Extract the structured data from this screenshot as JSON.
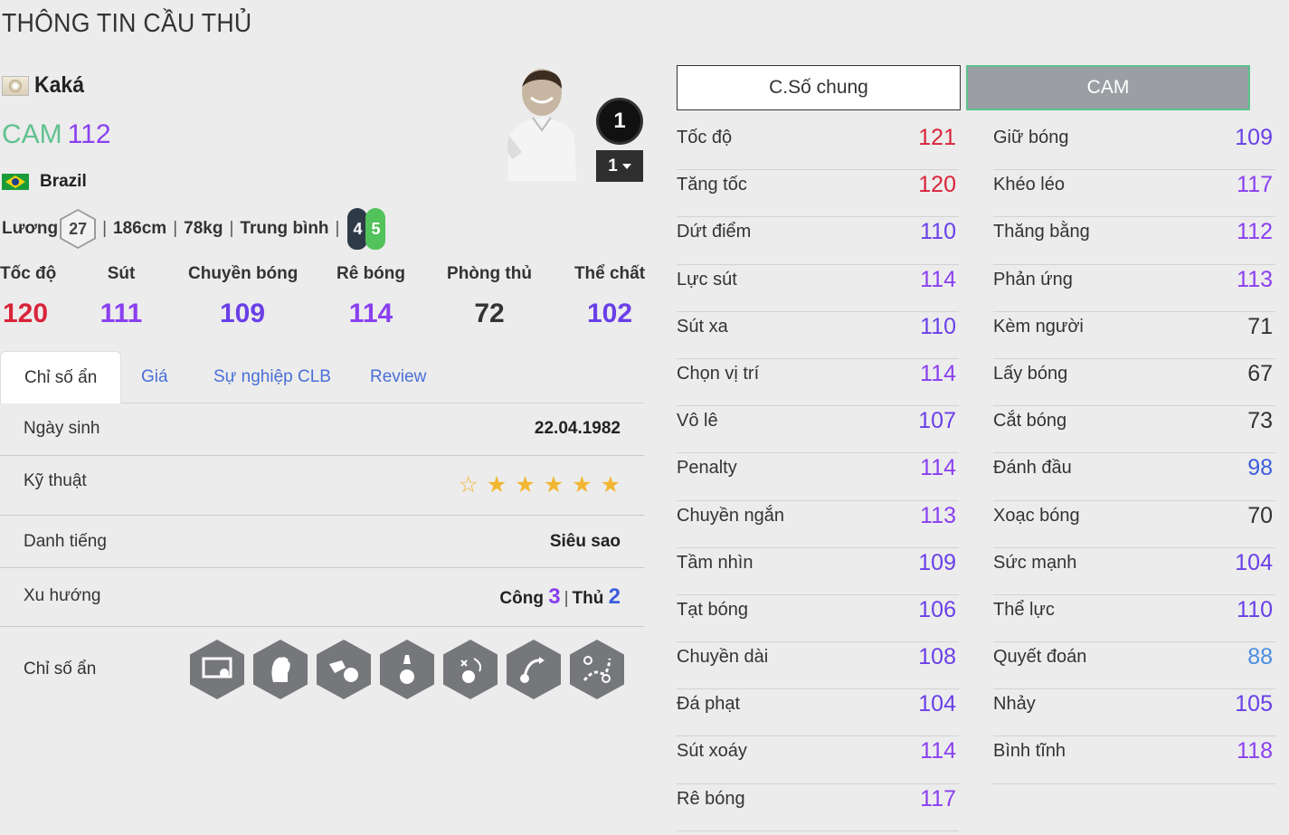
{
  "page_title": "THÔNG TIN CẦU THỦ",
  "player": {
    "name": "Kaká",
    "position": "CAM",
    "overall": "112",
    "nation": "Brazil",
    "salary_label": "Lương",
    "salary": "27",
    "height": "186cm",
    "weight": "78kg",
    "body_type": "Trung bình",
    "left_foot": "4",
    "right_foot": "5",
    "grade": "1",
    "grade_select": "1"
  },
  "summary": [
    {
      "label": "Tốc độ",
      "value": "120",
      "color": "#d8243a"
    },
    {
      "label": "Sút",
      "value": "111",
      "color": "#8a3ff0"
    },
    {
      "label": "Chuyền bóng",
      "value": "109",
      "color": "#6a3fe8"
    },
    {
      "label": "Rê bóng",
      "value": "114",
      "color": "#8a3ff0"
    },
    {
      "label": "Phòng thủ",
      "value": "72",
      "color": "#333333"
    },
    {
      "label": "Thể chất",
      "value": "102",
      "color": "#6a3fe8"
    }
  ],
  "tabs": [
    "Chỉ số ẩn",
    "Giá",
    "Sự nghiệp CLB",
    "Review"
  ],
  "details": {
    "birth_label": "Ngày sinh",
    "birth_value": "22.04.1982",
    "skill_label": "Kỹ thuật",
    "skill_stars": 5,
    "fame_label": "Danh tiếng",
    "fame_value": "Siêu sao",
    "trend_label": "Xu hướng",
    "attack_label": "Công",
    "attack_value": "3",
    "defense_label": "Thủ",
    "defense_value": "2",
    "traits_label": "Chỉ số ẩn",
    "trait_icons": [
      "finesse-shot-icon",
      "flair-icon",
      "speed-dribbler-icon",
      "power-header-icon",
      "technical-dribbler-icon",
      "long-shot-icon",
      "playmaker-icon"
    ]
  },
  "right_tabs": {
    "general": "C.Số chung",
    "position": "CAM"
  },
  "stats_left": [
    {
      "name": "Tốc độ",
      "value": "121",
      "color": "#d8243a"
    },
    {
      "name": "Tăng tốc",
      "value": "120",
      "color": "#d8243a"
    },
    {
      "name": "Dứt điểm",
      "value": "110",
      "color": "#6a3fe8"
    },
    {
      "name": "Lực sút",
      "value": "114",
      "color": "#8a3ff0"
    },
    {
      "name": "Sút xa",
      "value": "110",
      "color": "#6a3fe8"
    },
    {
      "name": "Chọn vị trí",
      "value": "114",
      "color": "#8a3ff0"
    },
    {
      "name": "Vô lê",
      "value": "107",
      "color": "#6a3fe8"
    },
    {
      "name": "Penalty",
      "value": "114",
      "color": "#8a3ff0"
    },
    {
      "name": "Chuyền ngắn",
      "value": "113",
      "color": "#8a3ff0"
    },
    {
      "name": "Tầm nhìn",
      "value": "109",
      "color": "#6a3fe8"
    },
    {
      "name": "Tạt bóng",
      "value": "106",
      "color": "#6a3fe8"
    },
    {
      "name": "Chuyền dài",
      "value": "108",
      "color": "#6a3fe8"
    },
    {
      "name": "Đá phạt",
      "value": "104",
      "color": "#6a3fe8"
    },
    {
      "name": "Sút xoáy",
      "value": "114",
      "color": "#8a3ff0"
    },
    {
      "name": "Rê bóng",
      "value": "117",
      "color": "#8a3ff0"
    }
  ],
  "stats_right": [
    {
      "name": "Giữ bóng",
      "value": "109",
      "color": "#6a3fe8"
    },
    {
      "name": "Khéo léo",
      "value": "117",
      "color": "#8a3ff0"
    },
    {
      "name": "Thăng bằng",
      "value": "112",
      "color": "#8a3ff0"
    },
    {
      "name": "Phản ứng",
      "value": "113",
      "color": "#8a3ff0"
    },
    {
      "name": "Kèm người",
      "value": "71",
      "color": "#333333"
    },
    {
      "name": "Lấy bóng",
      "value": "67",
      "color": "#333333"
    },
    {
      "name": "Cắt bóng",
      "value": "73",
      "color": "#333333"
    },
    {
      "name": "Đánh đầu",
      "value": "98",
      "color": "#3d5ddc"
    },
    {
      "name": "Xoạc bóng",
      "value": "70",
      "color": "#333333"
    },
    {
      "name": "Sức mạnh",
      "value": "104",
      "color": "#6a3fe8"
    },
    {
      "name": "Thể lực",
      "value": "110",
      "color": "#6a3fe8"
    },
    {
      "name": "Quyết đoán",
      "value": "88",
      "color": "#4a8ee0"
    },
    {
      "name": "Nhảy",
      "value": "105",
      "color": "#6a3fe8"
    },
    {
      "name": "Bình tĩnh",
      "value": "118",
      "color": "#8a3ff0"
    }
  ]
}
